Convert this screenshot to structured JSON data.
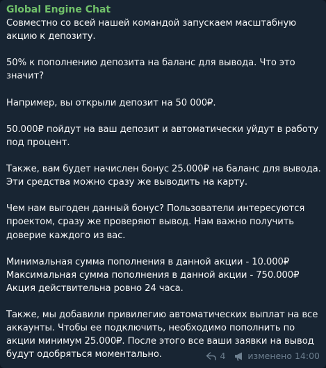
{
  "message": {
    "sender": "Global Engine Chat",
    "paragraphs": [
      [
        "Совместно со всей нашей командой запускаем масштабную",
        "акцию к депозиту."
      ],
      [
        "50% к пополнению депозита на баланс для вывода. Что это",
        "значит?"
      ],
      [
        "Например, вы открыли депозит на 50 000₽."
      ],
      [
        "50.000₽ пойдут на ваш депозит и автоматически уйдут в работу",
        "под процент."
      ],
      [
        "Также, вам будет начислен бонус 25.000₽ на баланс для вывода.",
        "Эти средства можно сразу же выводить на карту."
      ],
      [
        "Чем нам выгоден данный бонус? Пользователи интересуются",
        "проектом, сразу же проверяют вывод. Нам важно получить",
        "доверие каждого из вас."
      ],
      [
        "Минимальная сумма пополнения в данной акции - 10.000₽",
        "Максимальная сумма пополнения в данной акции - 750.000₽",
        "Акция действительна ровно 24 часа."
      ],
      [
        "Также, мы добавили привилегию автоматических выплат на все",
        "аккаунты. Чтобы ее подключить, необходимо пополнить по",
        "акции минимум 25.000₽. После этого все ваши заявки на вывод",
        "будут одобряться моментально."
      ]
    ],
    "forward_count": "4",
    "edited_time": "изменено 14:00",
    "icons": {
      "forward": "reply-arrow-icon",
      "views": "megaphone-icon"
    },
    "colors": {
      "sender": "#71c16a",
      "bubble": "#182533",
      "meta": "#6d7f8f"
    }
  }
}
